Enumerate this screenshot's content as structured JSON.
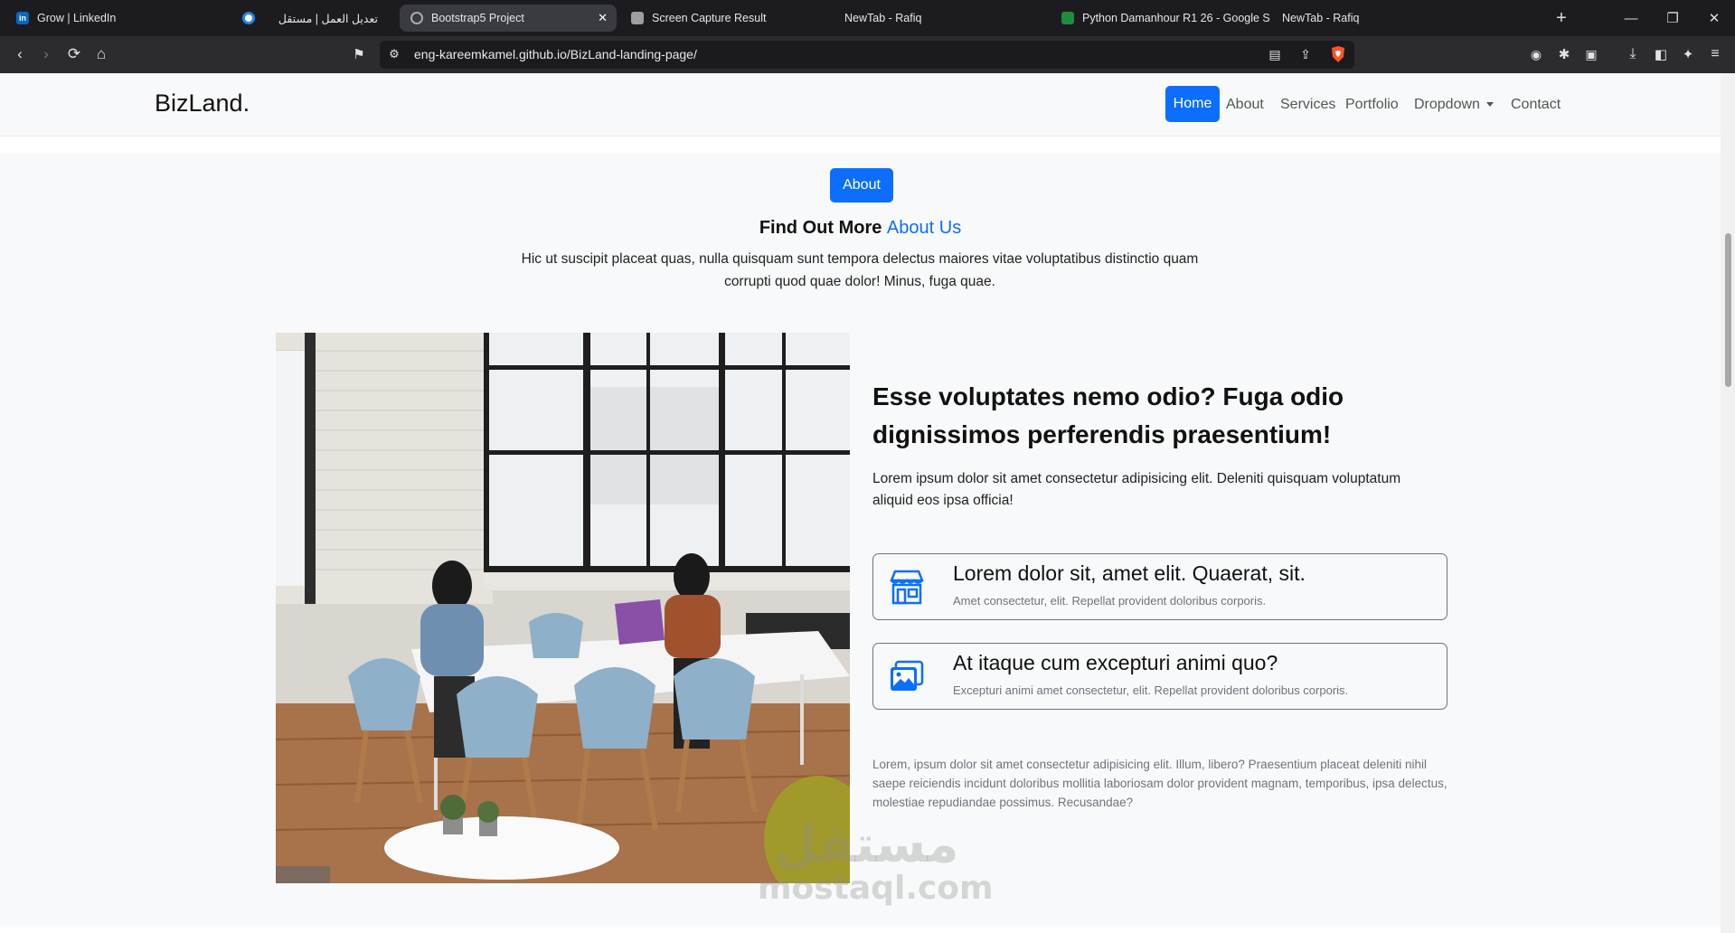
{
  "browser": {
    "tabs": [
      {
        "title": "Grow | LinkedIn",
        "favicon": "linkedin-icon",
        "favicon_text": "in",
        "color": "#0a66c2"
      },
      {
        "title": "",
        "favicon": "circle-icon",
        "color": "#1e88e5"
      },
      {
        "title": "تعديل العمل | مستقل",
        "favicon": "",
        "color": ""
      },
      {
        "title": "Bootstrap5 Project",
        "favicon": "globe-icon",
        "color": "#888888",
        "active": true
      },
      {
        "title": "Screen Capture Result",
        "favicon": "camera-icon",
        "color": "#9e9e9e"
      },
      {
        "title": "NewTab - Rafiq",
        "favicon": "",
        "color": ""
      },
      {
        "title": "Python Damanhour R1 26 - Google S",
        "favicon": "sheets-icon",
        "color": "#1e8e3e"
      },
      {
        "title": "NewTab - Rafiq",
        "favicon": "",
        "color": ""
      }
    ],
    "url": "eng-kareemkamel.github.io/BizLand-landing-page/"
  },
  "nav": {
    "brand": "BizLand.",
    "items": [
      "Home",
      "About",
      "Services",
      "Portfolio",
      "Dropdown",
      "Contact"
    ]
  },
  "about": {
    "badge": "About",
    "title_prefix": "Find Out More",
    "title_accent": "About Us",
    "intro": "Hic ut suscipit placeat quas, nulla quisquam sunt tempora delectus maiores vitae voluptatibus distinctio quam corrupti quod quae dolor! Minus, fuga quae.",
    "heading": "Esse voluptates nemo odio? Fuga odio dignissimos perferendis praesentium!",
    "lead": "Lorem ipsum dolor sit amet consectetur adipisicing elit. Deleniti quisquam voluptatum aliquid eos ipsa officia!",
    "features": [
      {
        "icon": "shop-icon",
        "title": "Lorem dolor sit, amet elit. Quaerat, sit.",
        "subtitle": "Amet consectetur, elit. Repellat provident doloribus corporis."
      },
      {
        "icon": "images-icon",
        "title": "At itaque cum excepturi animi quo?",
        "subtitle": "Excepturi animi amet consectetur, elit. Repellat provident doloribus corporis."
      }
    ],
    "closing": "Lorem, ipsum dolor sit amet consectetur adipisicing elit. Illum, libero? Praesentium placeat deleniti nihil saepe reiciendis incidunt doloribus mollitia laboriosam dolor provident magnam, temporibus, ipsa delectus, molestiae repudiandae possimus. Recusandae?"
  },
  "watermark": {
    "arabic": "مستقل",
    "latin": "mostaql.com"
  },
  "colors": {
    "primary": "#0d6efd",
    "chrome": "#1c1c20"
  }
}
